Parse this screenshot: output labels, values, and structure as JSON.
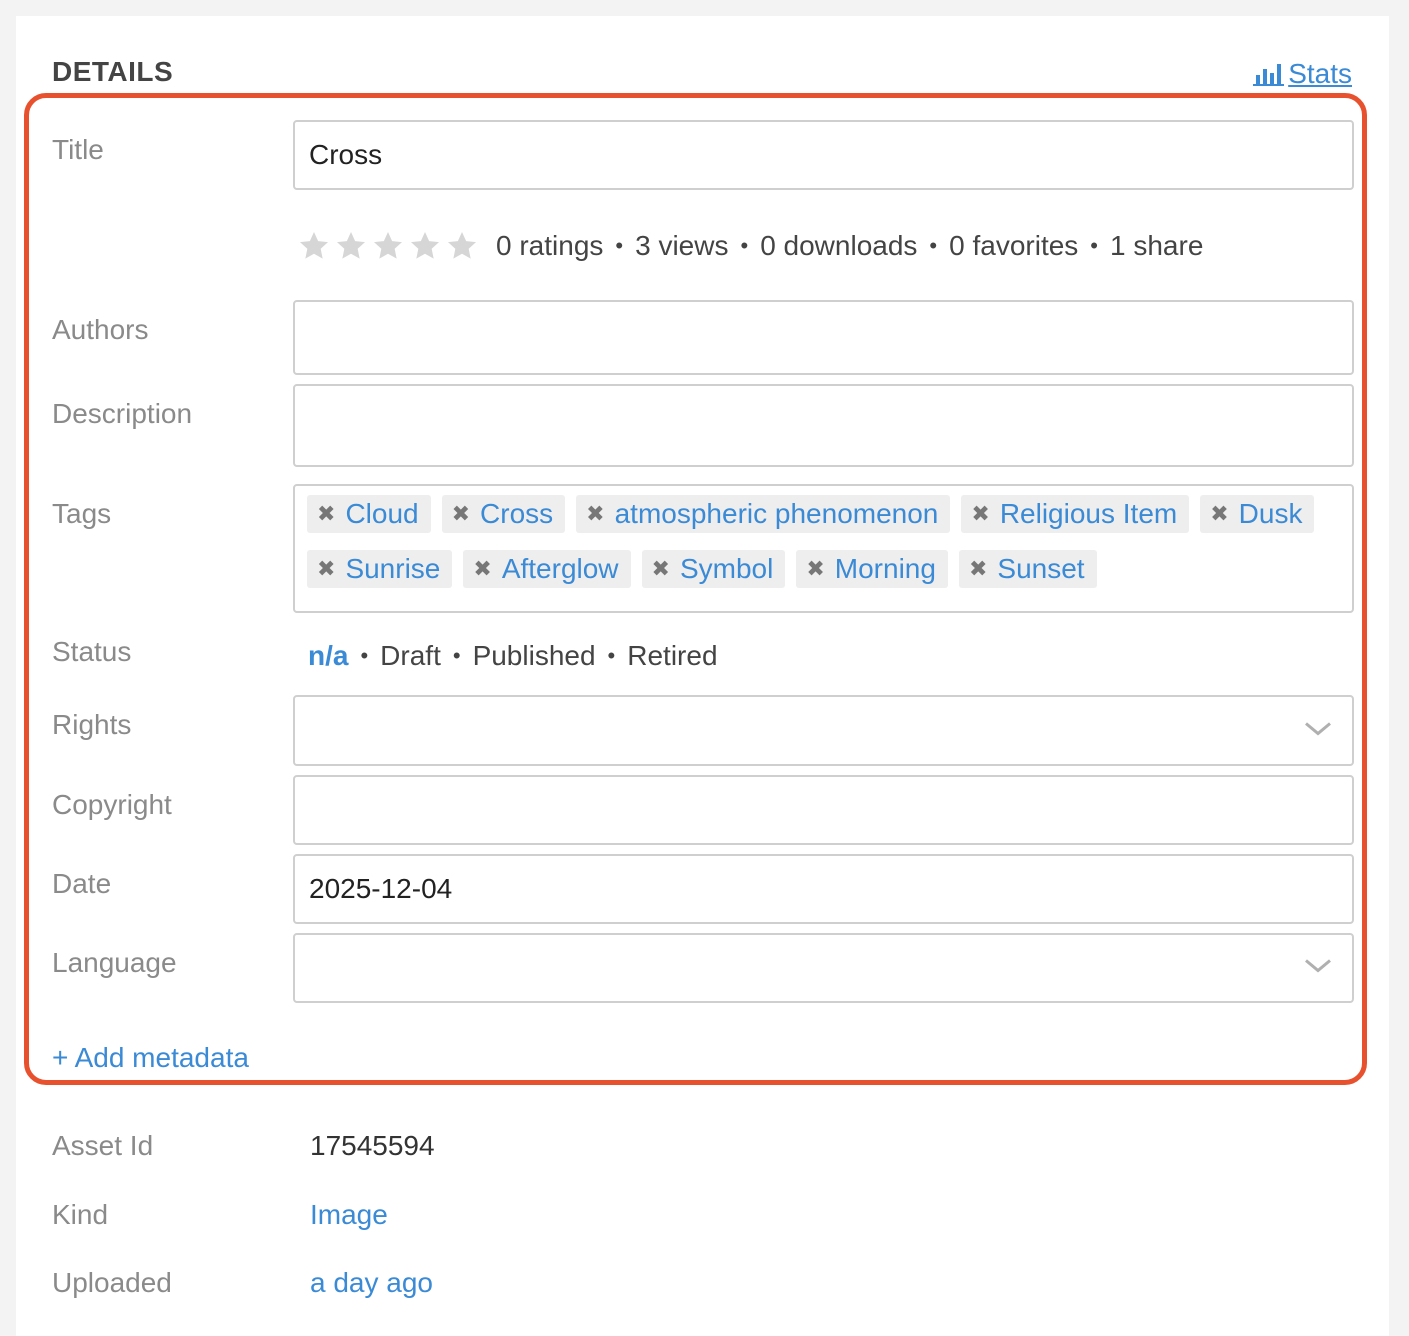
{
  "header": {
    "title": "DETAILS",
    "stats_label": "Stats"
  },
  "fields": {
    "title": {
      "label": "Title",
      "value": "Cross"
    },
    "authors": {
      "label": "Authors",
      "value": ""
    },
    "description": {
      "label": "Description",
      "value": ""
    },
    "tags": {
      "label": "Tags"
    },
    "status": {
      "label": "Status"
    },
    "rights": {
      "label": "Rights",
      "value": ""
    },
    "copyright": {
      "label": "Copyright",
      "value": ""
    },
    "date": {
      "label": "Date",
      "value": "2025-12-04"
    },
    "language": {
      "label": "Language",
      "value": ""
    }
  },
  "rating": {
    "stars_filled": 0,
    "stars_total": 5
  },
  "stats": [
    "0 ratings",
    "3 views",
    "0 downloads",
    "0 favorites",
    "1 share"
  ],
  "tags": [
    "Cloud",
    "Cross",
    "atmospheric phenomenon",
    "Religious Item",
    "Dusk",
    "Sunrise",
    "Afterglow",
    "Symbol",
    "Morning",
    "Sunset"
  ],
  "status_options": [
    {
      "label": "n/a",
      "active": true
    },
    {
      "label": "Draft",
      "active": false
    },
    {
      "label": "Published",
      "active": false
    },
    {
      "label": "Retired",
      "active": false
    }
  ],
  "add_metadata_label": "+ Add metadata",
  "info": {
    "asset_id": {
      "label": "Asset Id",
      "value": "17545594"
    },
    "kind": {
      "label": "Kind",
      "value": "Image"
    },
    "uploaded": {
      "label": "Uploaded",
      "value": "a day ago"
    }
  },
  "colors": {
    "accent": "#3a8ad6",
    "highlight": "#e8512e",
    "star_empty": "#d6d6d6"
  },
  "icons": {
    "stats": "bar-chart-icon",
    "star": "star-icon",
    "tag_remove": "close-icon",
    "select": "chevron-down-icon"
  }
}
